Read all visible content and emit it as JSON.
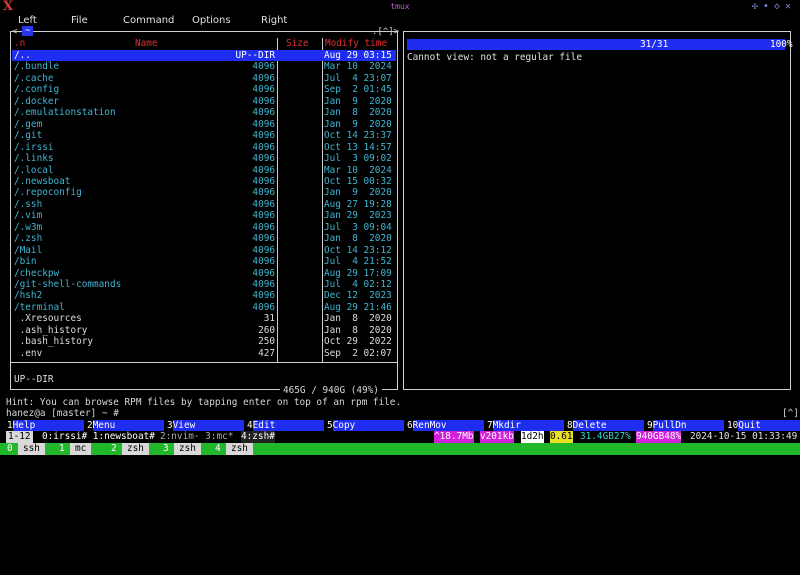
{
  "window": {
    "title": "tmux",
    "logo": "X"
  },
  "menu": [
    "Left",
    "File",
    "Command",
    "Options",
    "Right"
  ],
  "left_panel": {
    "path_tab": "~",
    "path_prefix": "<-",
    "path_suffix": ".[^]>",
    "headers": {
      "sort": ".n",
      "name": "Name",
      "size": "Size",
      "modify": "Modify time"
    },
    "rows": [
      {
        "name": "/..",
        "size": "UP--DIR",
        "mtime": "Aug 29 03:15",
        "type": "dir",
        "selected": true
      },
      {
        "name": "/.bundle",
        "size": "4096",
        "mtime": "Mar 10  2024",
        "type": "dir"
      },
      {
        "name": "/.cache",
        "size": "4096",
        "mtime": "Jul  4 23:07",
        "type": "dir"
      },
      {
        "name": "/.config",
        "size": "4096",
        "mtime": "Sep  2 01:45",
        "type": "dir"
      },
      {
        "name": "/.docker",
        "size": "4096",
        "mtime": "Jan  9  2020",
        "type": "dir"
      },
      {
        "name": "/.emulationstation",
        "size": "4096",
        "mtime": "Jan  8  2020",
        "type": "dir"
      },
      {
        "name": "/.gem",
        "size": "4096",
        "mtime": "Jan  9  2020",
        "type": "dir"
      },
      {
        "name": "/.git",
        "size": "4096",
        "mtime": "Oct 14 23:37",
        "type": "dir"
      },
      {
        "name": "/.irssi",
        "size": "4096",
        "mtime": "Oct 13 14:57",
        "type": "dir"
      },
      {
        "name": "/.links",
        "size": "4096",
        "mtime": "Jul  3 09:02",
        "type": "dir"
      },
      {
        "name": "/.local",
        "size": "4096",
        "mtime": "Mar 10  2024",
        "type": "dir"
      },
      {
        "name": "/.newsboat",
        "size": "4096",
        "mtime": "Oct 15 00:32",
        "type": "dir"
      },
      {
        "name": "/.repoconfig",
        "size": "4096",
        "mtime": "Jan  9  2020",
        "type": "dir"
      },
      {
        "name": "/.ssh",
        "size": "4096",
        "mtime": "Aug 27 19:28",
        "type": "dir"
      },
      {
        "name": "/.vim",
        "size": "4096",
        "mtime": "Jan 29  2023",
        "type": "dir"
      },
      {
        "name": "/.w3m",
        "size": "4096",
        "mtime": "Jul  3 09:04",
        "type": "dir"
      },
      {
        "name": "/.zsh",
        "size": "4096",
        "mtime": "Jan  8  2020",
        "type": "dir"
      },
      {
        "name": "/Mail",
        "size": "4096",
        "mtime": "Oct 14 23:12",
        "type": "dir"
      },
      {
        "name": "/bin",
        "size": "4096",
        "mtime": "Jul  4 21:52",
        "type": "dir"
      },
      {
        "name": "/checkpw",
        "size": "4096",
        "mtime": "Aug 29 17:09",
        "type": "dir"
      },
      {
        "name": "/git-shell-commands",
        "size": "4096",
        "mtime": "Jul  4 02:12",
        "type": "dir"
      },
      {
        "name": "/hsh2",
        "size": "4096",
        "mtime": "Dec 12  2023",
        "type": "dir"
      },
      {
        "name": "/terminal",
        "size": "4096",
        "mtime": "Aug 29 21:46",
        "type": "dir"
      },
      {
        "name": " .Xresources",
        "size": "31",
        "mtime": "Jan  8  2020",
        "type": "file"
      },
      {
        "name": " .ash_history",
        "size": "260",
        "mtime": "Jan  8  2020",
        "type": "file"
      },
      {
        "name": " .bash_history",
        "size": "250",
        "mtime": "Oct 29  2022",
        "type": "file"
      },
      {
        "name": " .env",
        "size": "427",
        "mtime": "Sep  2 02:07",
        "type": "file"
      }
    ],
    "status": "UP--DIR",
    "disk": "465G / 940G (49%)"
  },
  "right_panel": {
    "progress_count": "31/31",
    "progress_pct": "100%",
    "progress_fraction": 1.0,
    "message": "Cannot view: not a regular file"
  },
  "hint": "Hint: You can browse RPM files by tapping enter on top of an rpm file.",
  "prompt": "hanez@a [master] ~ #",
  "prompt_right": "[^]",
  "fkeys": [
    {
      "num": "1",
      "label": "Help"
    },
    {
      "num": "2",
      "label": "Menu"
    },
    {
      "num": "3",
      "label": "View"
    },
    {
      "num": "4",
      "label": "Edit"
    },
    {
      "num": "5",
      "label": "Copy"
    },
    {
      "num": "6",
      "label": "RenMov"
    },
    {
      "num": "7",
      "label": "Mkdir"
    },
    {
      "num": "8",
      "label": "Delete"
    },
    {
      "num": "9",
      "label": "PullDn"
    },
    {
      "num": "10",
      "label": "Quit"
    }
  ],
  "tmux": {
    "session": "1-12",
    "windows_active": "0:irssi# 1:newsboat#",
    "windows_inactive": "2:nvim- 3:mc*",
    "window_current": "4:zsh#",
    "mem": "^18.7Mb",
    "net": "v201kb",
    "uptime": "1d2h",
    "load": "0.61",
    "ram": "31.4GB27%",
    "disk": "940GB48%",
    "datetime": "2024-10-15 01:33:49"
  },
  "wm_windows": [
    {
      "num": "0",
      "label": "ssh"
    },
    {
      "num": "1",
      "label": "mc"
    },
    {
      "num": "2",
      "label": "zsh"
    },
    {
      "num": "3",
      "label": "zsh"
    },
    {
      "num": "4",
      "label": "zsh"
    }
  ],
  "colors": {
    "accent": "#1f2df0",
    "dir": "#3fb6d2",
    "header": "#e03030",
    "wm_bar": "#22b62b"
  }
}
